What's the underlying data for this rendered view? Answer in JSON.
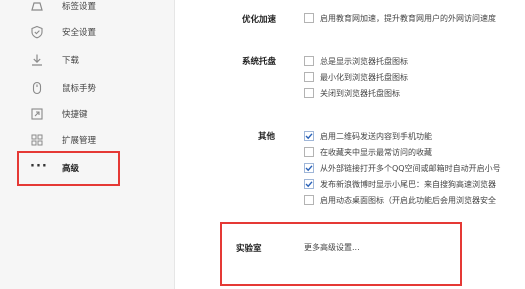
{
  "sidebar": {
    "items": [
      {
        "label": "标签设置",
        "icon": "tab-icon"
      },
      {
        "label": "安全设置",
        "icon": "shield-icon"
      },
      {
        "label": "下载",
        "icon": "download-icon"
      },
      {
        "label": "鼠标手势",
        "icon": "mouse-icon"
      },
      {
        "label": "快捷键",
        "icon": "shortcut-icon"
      },
      {
        "label": "扩展管理",
        "icon": "extensions-icon"
      },
      {
        "label": "高级",
        "icon": "more-dots-icon",
        "glyph": "···",
        "active": true
      }
    ]
  },
  "sections": {
    "edu": {
      "title": "优化加速",
      "options": [
        {
          "label": "启用教育网加速，提升教育网用户的外网访问速度",
          "checked": false
        }
      ]
    },
    "tray": {
      "title": "系统托盘",
      "options": [
        {
          "label": "总是显示浏览器托盘图标",
          "checked": false
        },
        {
          "label": "最小化到浏览器托盘图标",
          "checked": false
        },
        {
          "label": "关闭到浏览器托盘图标",
          "checked": false
        }
      ]
    },
    "other": {
      "title": "其他",
      "options": [
        {
          "label": "启用二维码发送内容到手机功能",
          "checked": true
        },
        {
          "label": "在收藏夹中显示最常访问的收藏",
          "checked": false
        },
        {
          "label": "从外部链接打开多个QQ空间或邮箱时自动开启小号",
          "checked": true
        },
        {
          "label": "发布新浪微博时显示小尾巴：来自搜狗高速浏览器",
          "checked": true
        },
        {
          "label": "启用动态桌面图标（开启此功能后会用浏览器安全",
          "checked": false
        }
      ]
    },
    "lab": {
      "title": "实验室",
      "link": "更多高级设置..."
    }
  },
  "colors": {
    "highlight": "#e53935",
    "check": "#2a62b8",
    "sidebar_bg": "#f6f6f6"
  }
}
